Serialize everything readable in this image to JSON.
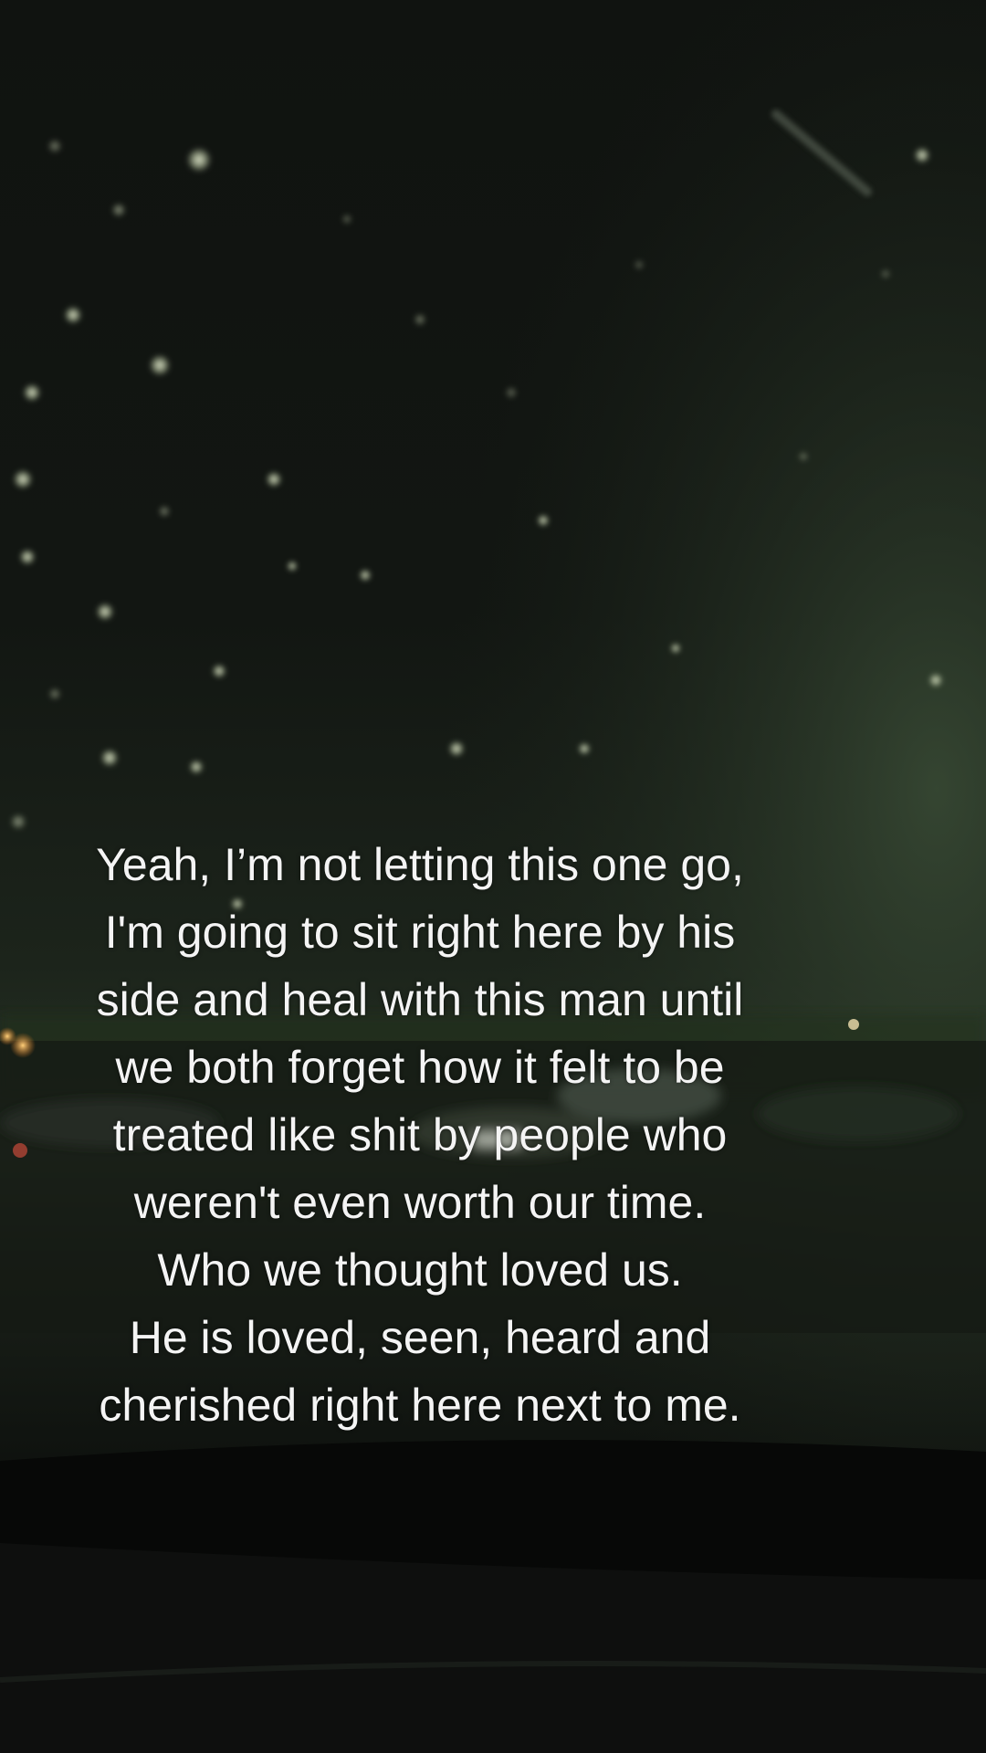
{
  "caption": {
    "lines": [
      "Yeah, I’m not letting this one go,",
      "I'm going to sit right here by his",
      "side and heal with this man until",
      "we both forget how it felt to be",
      "treated like shit by people who",
      "weren't even worth our time.",
      "Who we thought loved us.",
      "He is loved, seen, heard and",
      "cherished right here next to me."
    ],
    "color": "#f4f4f4"
  },
  "scene": {
    "description_colors": {
      "sky": "#0e120e",
      "horizon_glow": "#2c3a2a",
      "dashboard": "#050605",
      "bokeh": "#dfe8c8"
    }
  }
}
